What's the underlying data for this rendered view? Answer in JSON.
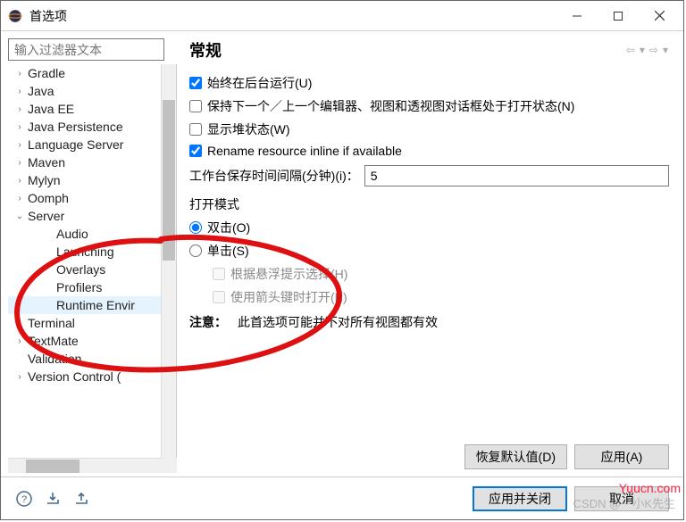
{
  "window": {
    "title": "首选项"
  },
  "sidebar": {
    "filter_placeholder": "输入过滤器文本",
    "items": [
      {
        "label": "Gradle",
        "expandable": true,
        "expanded": false,
        "depth": 0
      },
      {
        "label": "Java",
        "expandable": true,
        "expanded": false,
        "depth": 0
      },
      {
        "label": "Java EE",
        "expandable": true,
        "expanded": false,
        "depth": 0
      },
      {
        "label": "Java Persistence",
        "expandable": true,
        "expanded": false,
        "depth": 0
      },
      {
        "label": "Language Server",
        "expandable": true,
        "expanded": false,
        "depth": 0
      },
      {
        "label": "Maven",
        "expandable": true,
        "expanded": false,
        "depth": 0
      },
      {
        "label": "Mylyn",
        "expandable": true,
        "expanded": false,
        "depth": 0
      },
      {
        "label": "Oomph",
        "expandable": true,
        "expanded": false,
        "depth": 0
      },
      {
        "label": "Server",
        "expandable": true,
        "expanded": true,
        "depth": 0
      },
      {
        "label": "Audio",
        "expandable": false,
        "depth": 1
      },
      {
        "label": "Launching",
        "expandable": false,
        "depth": 1
      },
      {
        "label": "Overlays",
        "expandable": false,
        "depth": 1
      },
      {
        "label": "Profilers",
        "expandable": false,
        "depth": 1
      },
      {
        "label": "Runtime Envir",
        "expandable": false,
        "depth": 1,
        "selected": true
      },
      {
        "label": "Terminal",
        "expandable": true,
        "expanded": false,
        "depth": 0
      },
      {
        "label": "TextMate",
        "expandable": true,
        "expanded": false,
        "depth": 0
      },
      {
        "label": "Validation",
        "expandable": false,
        "depth": 0
      },
      {
        "label": "Version Control (",
        "expandable": true,
        "expanded": false,
        "depth": 0
      }
    ]
  },
  "main": {
    "title": "常规",
    "checkbox_run_bg": "始终在后台运行(U)",
    "checkbox_keep_editor": "保持下一个／上一个编辑器、视图和透视图对话框处于打开状态(N)",
    "checkbox_heap": "显示堆状态(W)",
    "checkbox_rename": "Rename resource inline if available",
    "save_interval_label": "工作台保存时间间隔(分钟)(i)：",
    "save_interval_value": "5",
    "open_mode_label": "打开模式",
    "radio_double": "双击(O)",
    "radio_single": "单击(S)",
    "checkbox_hover": "根据悬浮提示选择(H)",
    "checkbox_arrow": "使用箭头键时打开(K)",
    "note_label": "注意：",
    "note_text": "此首选项可能并不对所有视图都有效",
    "btn_restore": "恢复默认值(D)",
    "btn_apply": "应用(A)"
  },
  "bottom": {
    "btn_apply_close": "应用并关闭",
    "btn_cancel": "取消"
  },
  "watermark": "Yuucn.com",
  "csdn_watermark": "CSDN @一小K先生"
}
